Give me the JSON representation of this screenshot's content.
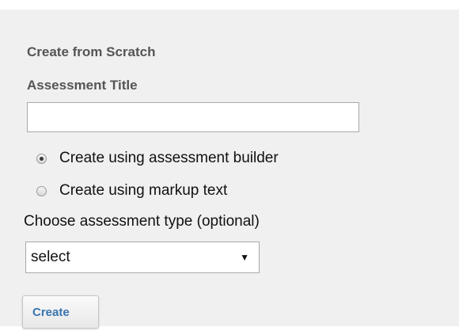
{
  "form": {
    "heading": "Create from Scratch",
    "title_label": "Assessment Title",
    "title_value": "",
    "title_placeholder": "",
    "options": [
      {
        "label": "Create using assessment builder",
        "checked": true
      },
      {
        "label": "Create using markup text",
        "checked": false
      }
    ],
    "type_label": "Choose assessment type (optional)",
    "type_selected": "select",
    "create_label": "Create"
  },
  "icons": {
    "select_arrow": "chevron-down-icon"
  },
  "colors": {
    "panel_background": "#f0f0f0",
    "heading_text": "#555555",
    "button_text": "#3a74b0"
  }
}
